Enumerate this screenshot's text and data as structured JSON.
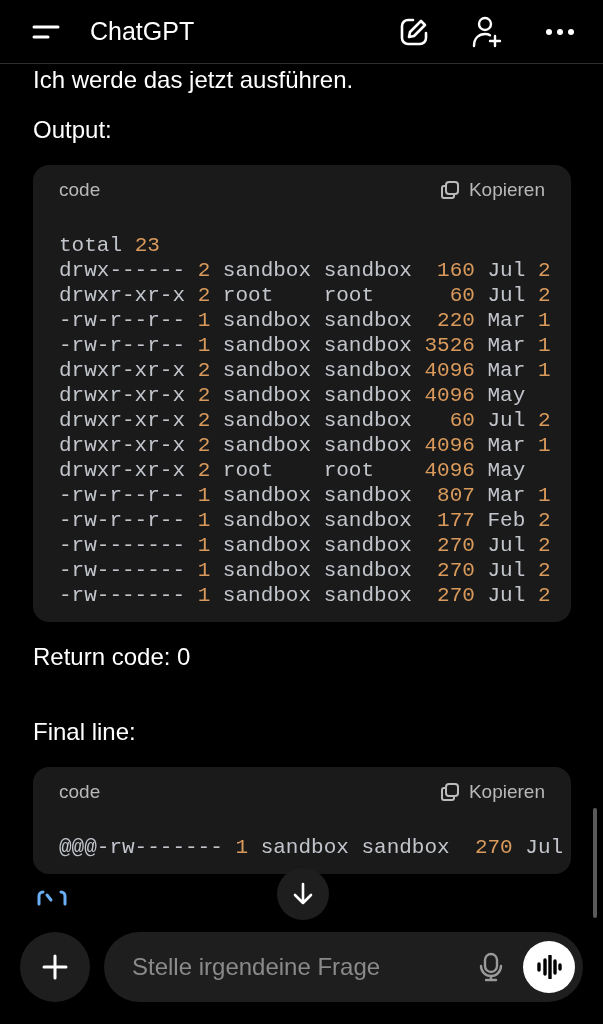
{
  "header": {
    "title": "ChatGPT"
  },
  "messages": [
    {
      "kind": "text",
      "text": "Ich werde das jetzt ausführen."
    },
    {
      "kind": "text",
      "text": "Output:"
    },
    {
      "kind": "code",
      "language": "code",
      "copy_label": "Kopieren",
      "lines": [
        [
          {
            "text": "total ",
            "kind": "plain"
          },
          {
            "text": "23",
            "kind": "num"
          }
        ],
        [
          {
            "text": "drwx------ ",
            "kind": "plain"
          },
          {
            "text": "2",
            "kind": "num"
          },
          {
            "text": " sandbox sandbox  ",
            "kind": "plain"
          },
          {
            "text": "160",
            "kind": "num"
          },
          {
            "text": " Jul ",
            "kind": "plain"
          },
          {
            "text": "2",
            "kind": "num"
          }
        ],
        [
          {
            "text": "drwxr-xr-x ",
            "kind": "plain"
          },
          {
            "text": "2",
            "kind": "num"
          },
          {
            "text": " root    root      ",
            "kind": "plain"
          },
          {
            "text": "60",
            "kind": "num"
          },
          {
            "text": " Jul ",
            "kind": "plain"
          },
          {
            "text": "2",
            "kind": "num"
          }
        ],
        [
          {
            "text": "-rw-r--r-- ",
            "kind": "plain"
          },
          {
            "text": "1",
            "kind": "num"
          },
          {
            "text": " sandbox sandbox  ",
            "kind": "plain"
          },
          {
            "text": "220",
            "kind": "num"
          },
          {
            "text": " Mar ",
            "kind": "plain"
          },
          {
            "text": "1",
            "kind": "num"
          }
        ],
        [
          {
            "text": "-rw-r--r-- ",
            "kind": "plain"
          },
          {
            "text": "1",
            "kind": "num"
          },
          {
            "text": " sandbox sandbox ",
            "kind": "plain"
          },
          {
            "text": "3526",
            "kind": "num"
          },
          {
            "text": " Mar ",
            "kind": "plain"
          },
          {
            "text": "1",
            "kind": "num"
          }
        ],
        [
          {
            "text": "drwxr-xr-x ",
            "kind": "plain"
          },
          {
            "text": "2",
            "kind": "num"
          },
          {
            "text": " sandbox sandbox ",
            "kind": "plain"
          },
          {
            "text": "4096",
            "kind": "num"
          },
          {
            "text": " Mar ",
            "kind": "plain"
          },
          {
            "text": "1",
            "kind": "num"
          }
        ],
        [
          {
            "text": "drwxr-xr-x ",
            "kind": "plain"
          },
          {
            "text": "2",
            "kind": "num"
          },
          {
            "text": " sandbox sandbox ",
            "kind": "plain"
          },
          {
            "text": "4096",
            "kind": "num"
          },
          {
            "text": " May",
            "kind": "plain"
          }
        ],
        [
          {
            "text": "drwxr-xr-x ",
            "kind": "plain"
          },
          {
            "text": "2",
            "kind": "num"
          },
          {
            "text": " sandbox sandbox   ",
            "kind": "plain"
          },
          {
            "text": "60",
            "kind": "num"
          },
          {
            "text": " Jul ",
            "kind": "plain"
          },
          {
            "text": "2",
            "kind": "num"
          }
        ],
        [
          {
            "text": "drwxr-xr-x ",
            "kind": "plain"
          },
          {
            "text": "2",
            "kind": "num"
          },
          {
            "text": " sandbox sandbox ",
            "kind": "plain"
          },
          {
            "text": "4096",
            "kind": "num"
          },
          {
            "text": " Mar ",
            "kind": "plain"
          },
          {
            "text": "1",
            "kind": "num"
          }
        ],
        [
          {
            "text": "drwxr-xr-x ",
            "kind": "plain"
          },
          {
            "text": "2",
            "kind": "num"
          },
          {
            "text": " root    root    ",
            "kind": "plain"
          },
          {
            "text": "4096",
            "kind": "num"
          },
          {
            "text": " May",
            "kind": "plain"
          }
        ],
        [
          {
            "text": "-rw-r--r-- ",
            "kind": "plain"
          },
          {
            "text": "1",
            "kind": "num"
          },
          {
            "text": " sandbox sandbox  ",
            "kind": "plain"
          },
          {
            "text": "807",
            "kind": "num"
          },
          {
            "text": " Mar ",
            "kind": "plain"
          },
          {
            "text": "1",
            "kind": "num"
          }
        ],
        [
          {
            "text": "-rw-r--r-- ",
            "kind": "plain"
          },
          {
            "text": "1",
            "kind": "num"
          },
          {
            "text": " sandbox sandbox  ",
            "kind": "plain"
          },
          {
            "text": "177",
            "kind": "num"
          },
          {
            "text": " Feb ",
            "kind": "plain"
          },
          {
            "text": "2",
            "kind": "num"
          }
        ],
        [
          {
            "text": "-rw------- ",
            "kind": "plain"
          },
          {
            "text": "1",
            "kind": "num"
          },
          {
            "text": " sandbox sandbox  ",
            "kind": "plain"
          },
          {
            "text": "270",
            "kind": "num"
          },
          {
            "text": " Jul ",
            "kind": "plain"
          },
          {
            "text": "2",
            "kind": "num"
          }
        ],
        [
          {
            "text": "-rw------- ",
            "kind": "plain"
          },
          {
            "text": "1",
            "kind": "num"
          },
          {
            "text": " sandbox sandbox  ",
            "kind": "plain"
          },
          {
            "text": "270",
            "kind": "num"
          },
          {
            "text": " Jul ",
            "kind": "plain"
          },
          {
            "text": "2",
            "kind": "num"
          }
        ],
        [
          {
            "text": "-rw------- ",
            "kind": "plain"
          },
          {
            "text": "1",
            "kind": "num"
          },
          {
            "text": " sandbox sandbox  ",
            "kind": "plain"
          },
          {
            "text": "270",
            "kind": "num"
          },
          {
            "text": " Jul ",
            "kind": "plain"
          },
          {
            "text": "2",
            "kind": "num"
          }
        ]
      ]
    },
    {
      "kind": "text",
      "text": "Return code: 0"
    },
    {
      "kind": "text",
      "text": "Final line:"
    },
    {
      "kind": "code",
      "language": "code",
      "copy_label": "Kopieren",
      "lines": [
        [
          {
            "text": "@@@-rw------- ",
            "kind": "plain"
          },
          {
            "text": "1",
            "kind": "num"
          },
          {
            "text": " sandbox sandbox  ",
            "kind": "plain"
          },
          {
            "text": "270",
            "kind": "num"
          },
          {
            "text": " Jul",
            "kind": "plain"
          }
        ]
      ]
    }
  ],
  "composer": {
    "placeholder": "Stelle irgendeine Frage"
  }
}
